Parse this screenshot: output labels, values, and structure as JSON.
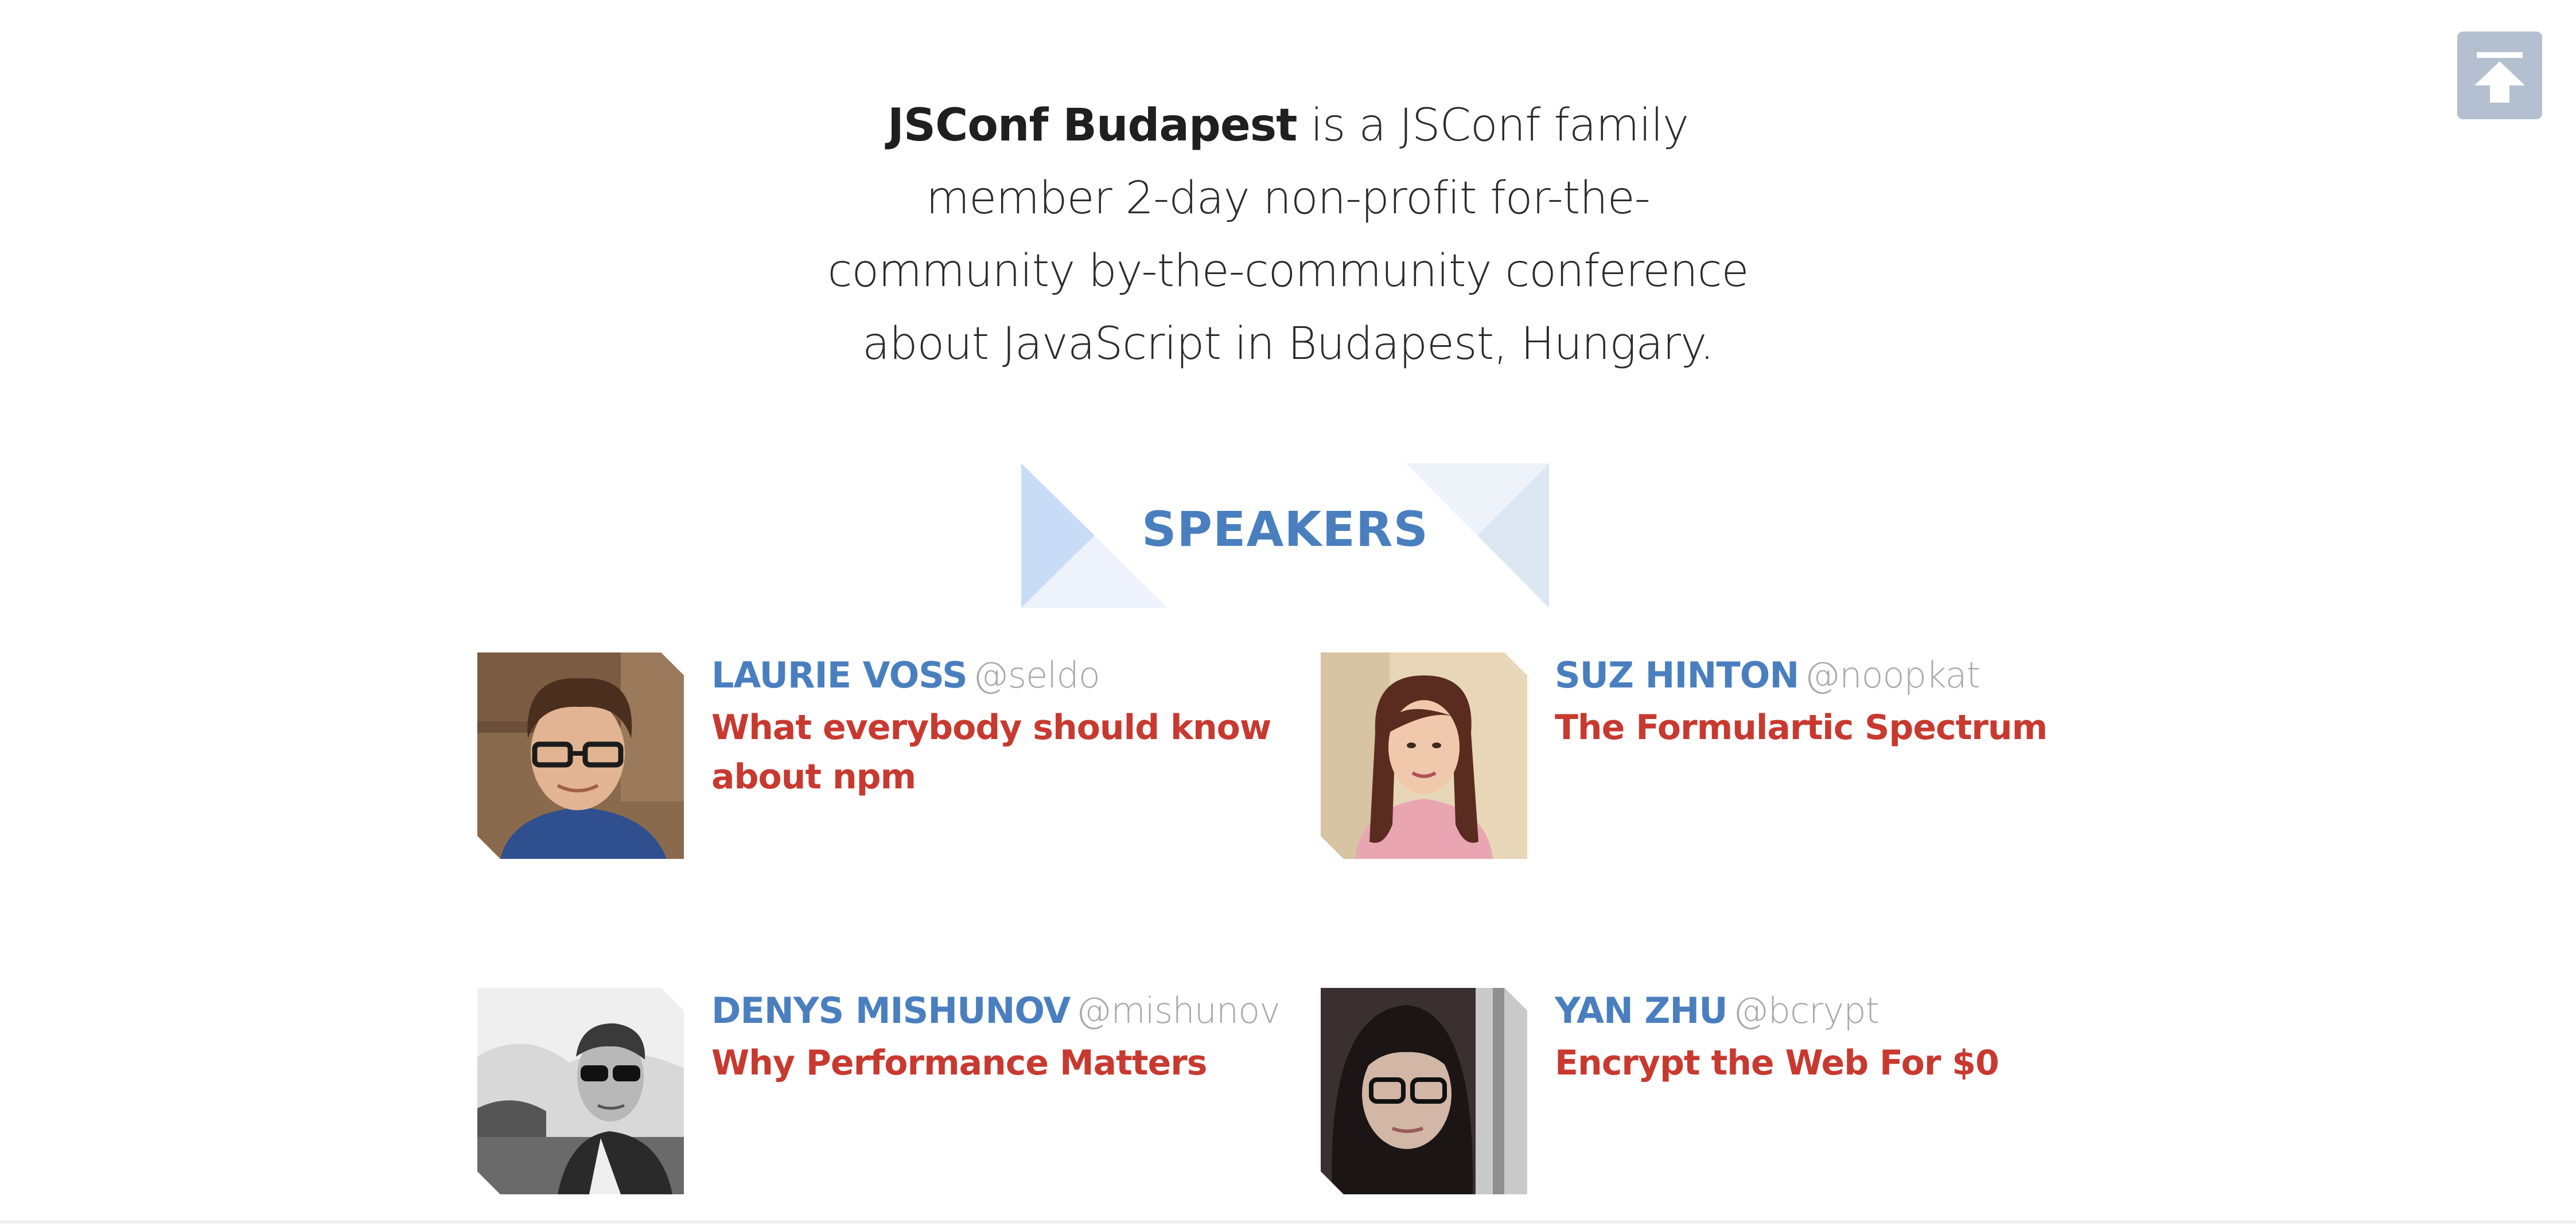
{
  "intro": {
    "brand": "JSConf Budapest",
    "text": " is a JSConf family member 2-day non-profit for-the-community by-the-community conference about JavaScript in Budapest, Hungary."
  },
  "back_to_top": {
    "icon": "arrow-up-to-top-icon"
  },
  "speakers_section": {
    "title": "SPEAKERS",
    "colors": {
      "accent": "#4a7fbf",
      "talk": "#c8392f",
      "handle": "#a9a9a9"
    }
  },
  "speakers": [
    {
      "name": "LAURIE VOSS",
      "handle": "@seldo",
      "talk": "What everybody should know about npm"
    },
    {
      "name": "SUZ HINTON",
      "handle": "@noopkat",
      "talk": "The Formulartic Spectrum"
    },
    {
      "name": "DENYS MISHUNOV",
      "handle": "@mishunov",
      "talk": "Why Performance Matters"
    },
    {
      "name": "YAN ZHU",
      "handle": "@bcrypt",
      "talk": "Encrypt the Web For $0"
    }
  ]
}
